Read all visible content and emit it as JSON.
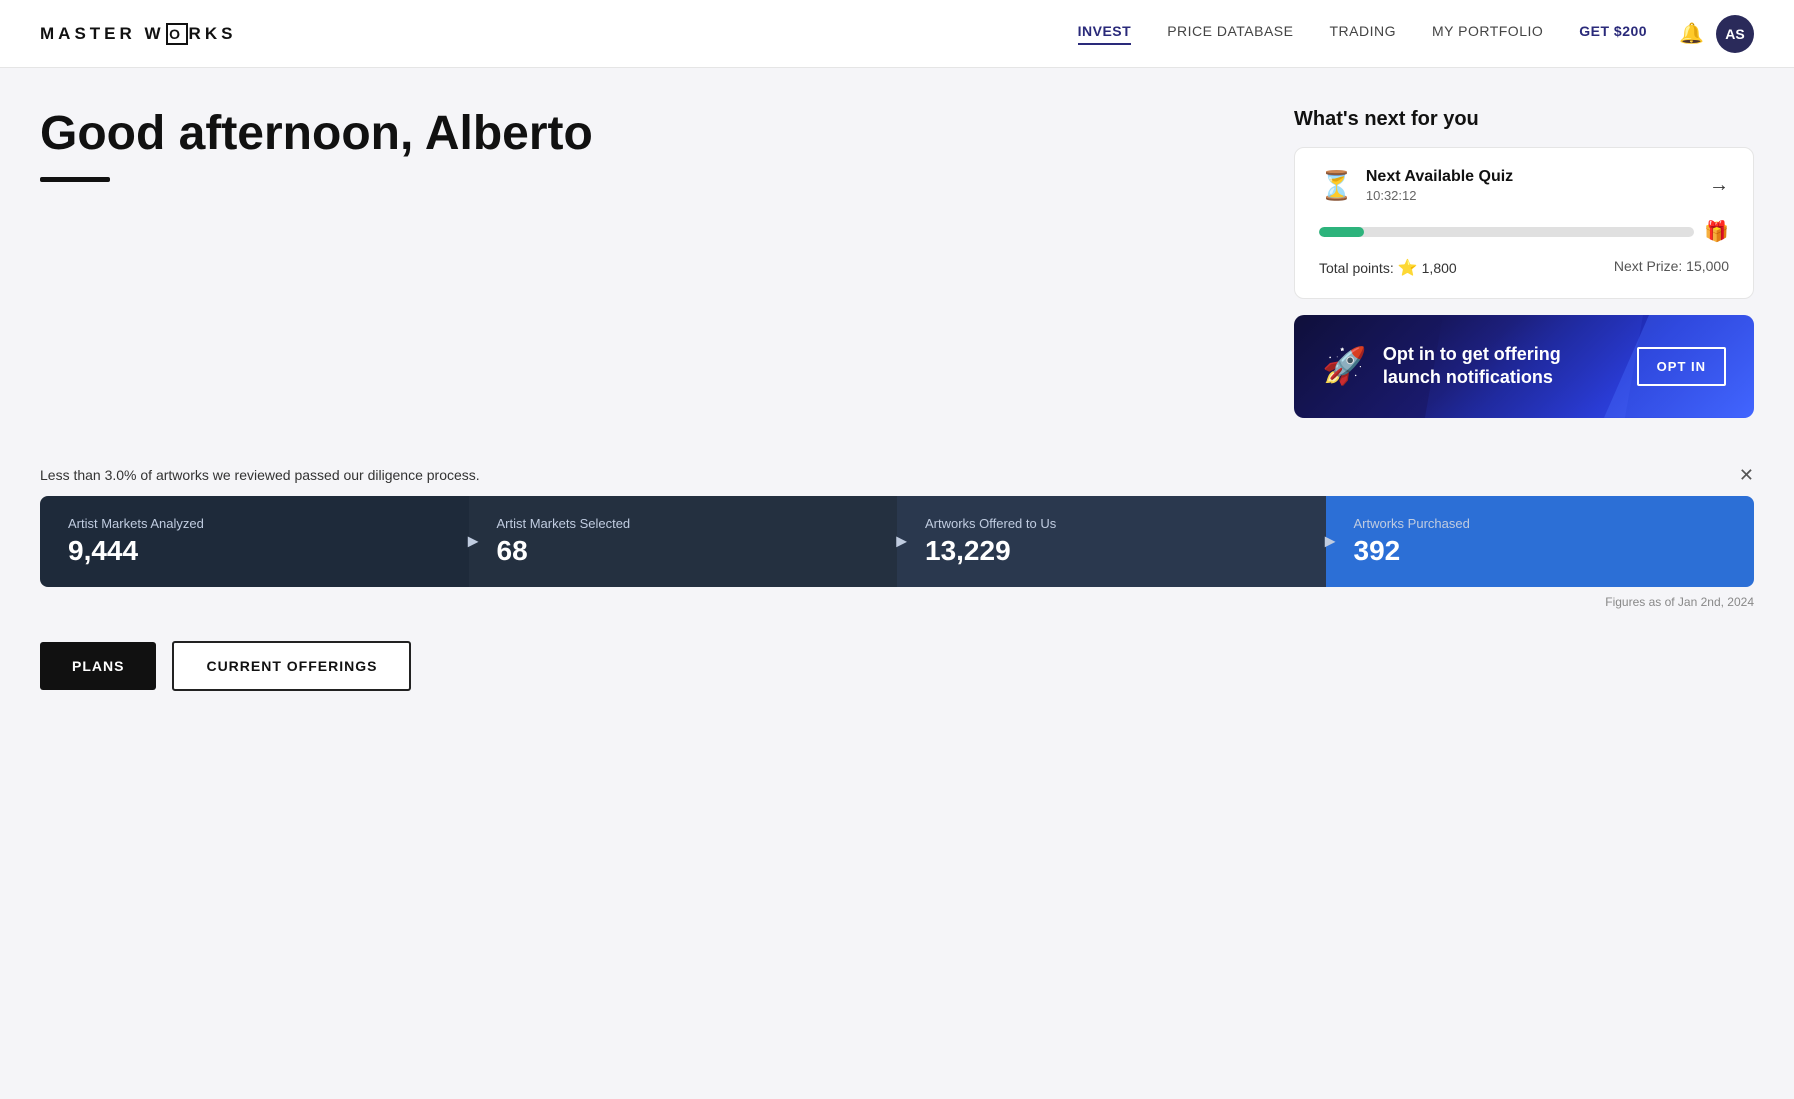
{
  "header": {
    "logo": "MASTERWORKS",
    "logo_letter": "O",
    "nav": [
      {
        "label": "INVEST",
        "active": true
      },
      {
        "label": "PRICE DATABASE",
        "active": false
      },
      {
        "label": "TRADING",
        "active": false
      },
      {
        "label": "MY PORTFOLIO",
        "active": false
      },
      {
        "label": "GET $200",
        "active": false,
        "special": true
      }
    ],
    "avatar_initials": "AS"
  },
  "main": {
    "greeting": "Good afternoon, Alberto"
  },
  "right_panel": {
    "section_title": "What's next for you",
    "quiz_card": {
      "title": "Next Available Quiz",
      "time": "10:32:12",
      "progress_percent": 12,
      "total_points_label": "Total points:",
      "total_points": "1,800",
      "next_prize_label": "Next Prize: 15,000"
    },
    "opt_in_card": {
      "text": "Opt in to get offering launch notifications",
      "button_label": "OPT IN"
    }
  },
  "stats": {
    "banner_text": "Less than 3.0% of artworks we reviewed passed our diligence process.",
    "figures_note": "Figures as of Jan 2nd, 2024",
    "items": [
      {
        "label": "Artist Markets Analyzed",
        "value": "9,444"
      },
      {
        "label": "Artist Markets Selected",
        "value": "68"
      },
      {
        "label": "Artworks Offered to Us",
        "value": "13,229"
      },
      {
        "label": "Artworks Purchased",
        "value": "392"
      }
    ]
  },
  "bottom_buttons": {
    "plans_label": "PLANS",
    "offerings_label": "CURRENT OFFERINGS"
  }
}
